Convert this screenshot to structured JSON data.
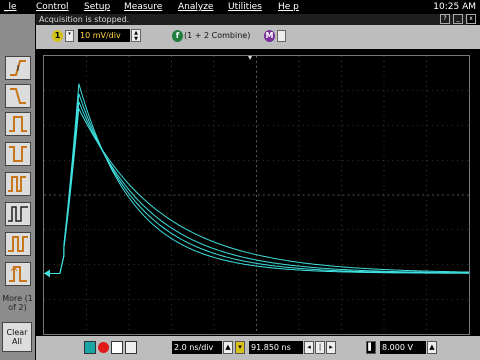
{
  "menu": {
    "items": [
      "_le",
      "Control",
      "Setup",
      "Measure",
      "Analyze",
      "Utilities",
      "He p"
    ],
    "clock": "10:25 AM"
  },
  "status": {
    "text": "Acquisition is stopped."
  },
  "window_controls": [
    "?",
    "_",
    "x"
  ],
  "channel1": {
    "badge": "1",
    "color": "#00e6e6",
    "scale": "10 mV/div"
  },
  "function": {
    "badge": "f",
    "label": "(1 + 2 Combine)",
    "color": "#1f7f3f"
  },
  "memory": {
    "badge": "M",
    "color": "#7a2f9a"
  },
  "left_panel": {
    "more_label": "More (1 of 2)",
    "clear_label": "Clear All"
  },
  "timebase": {
    "time_div": "2.0 ns/div",
    "delay": "91.850 ns",
    "trigger_level": "8.000 V"
  },
  "colors": {
    "trace": "#3fe0e0",
    "grid": "#666666",
    "panel": "#bdbdbd",
    "sidebar": "#8c8c8c"
  },
  "icons": [
    "edge-trigger-icon",
    "run-icon",
    "stop-icon",
    "single-icon",
    "print-icon"
  ]
}
